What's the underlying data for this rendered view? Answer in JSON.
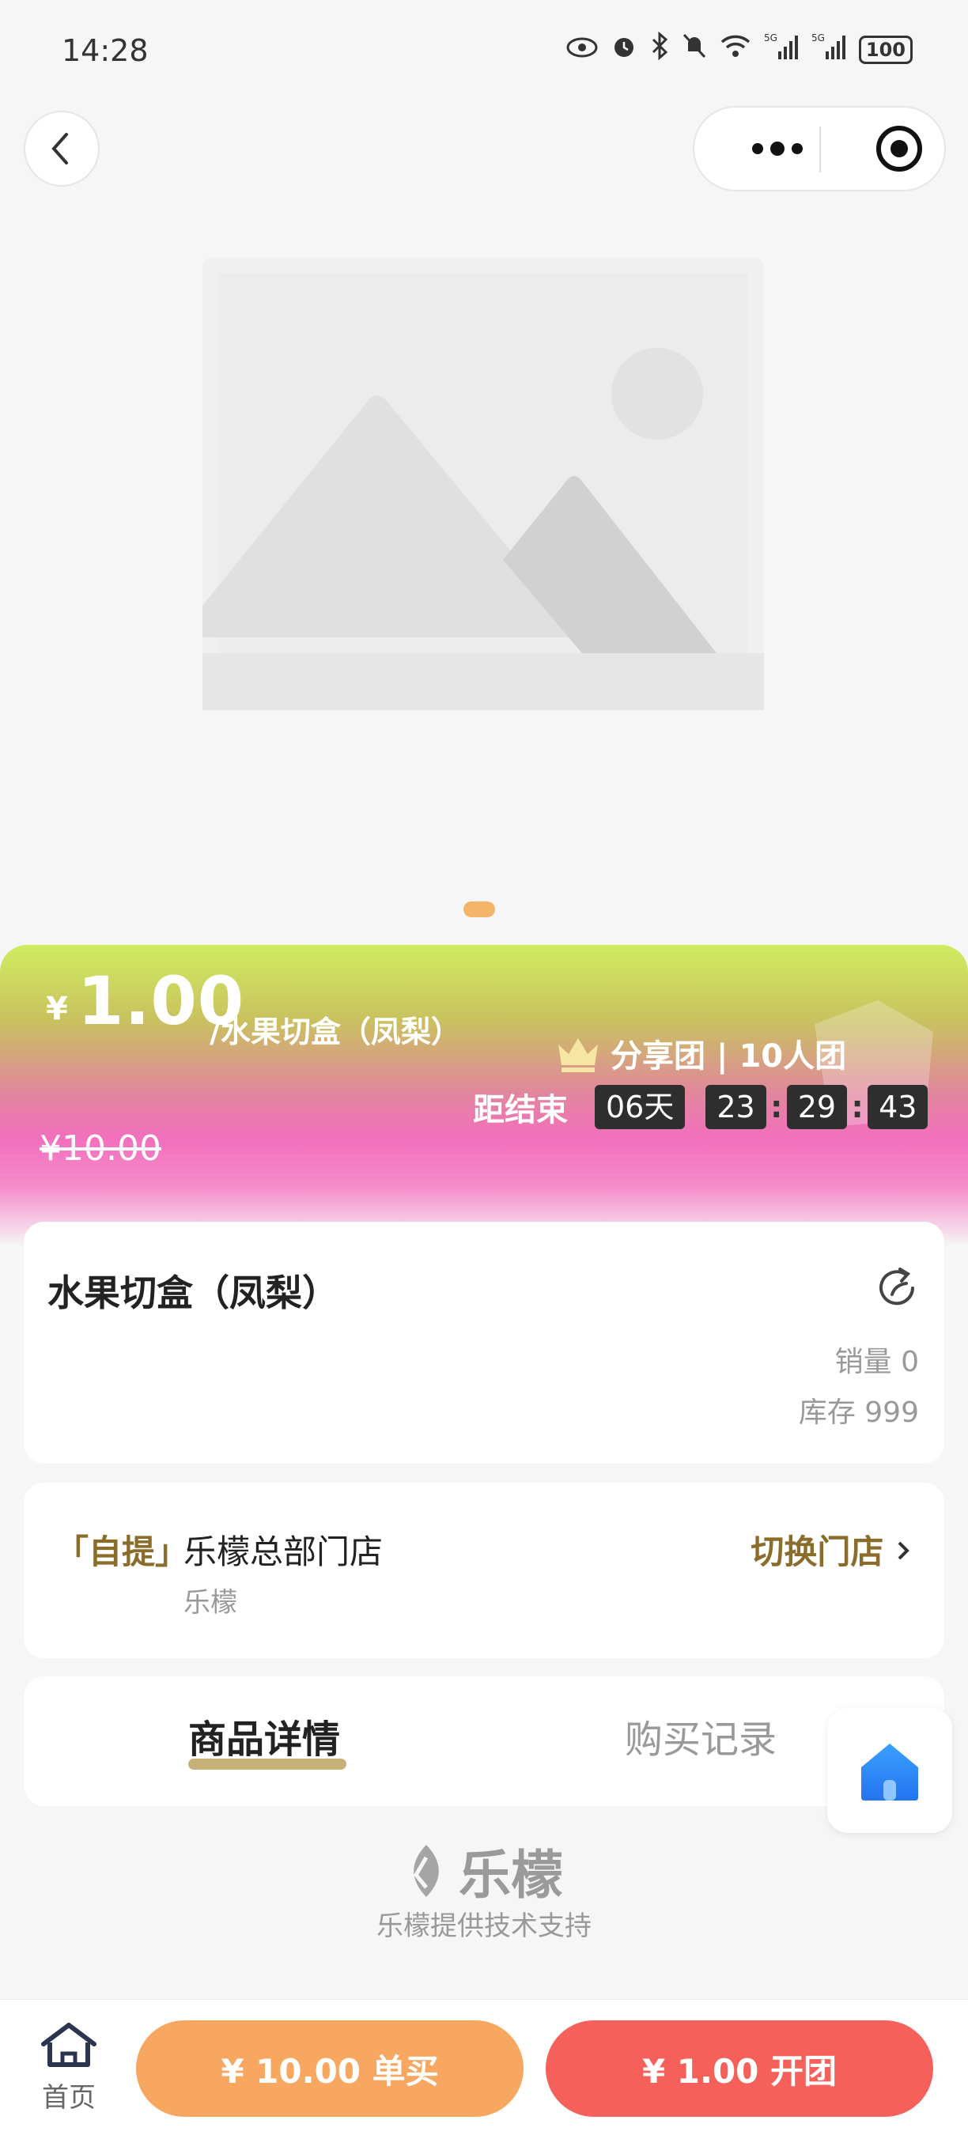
{
  "status_bar": {
    "time": "14:28",
    "icons": [
      "eye-icon",
      "alarm-icon",
      "bluetooth-icon",
      "mute-icon",
      "wifi-icon",
      "signal-5g-icon",
      "signal-5g-icon"
    ],
    "battery": "100"
  },
  "nav": {
    "back_icon": "chevron-left-icon",
    "more_icon": "more-dots-icon",
    "close_icon": "target-icon"
  },
  "gallery": {
    "image": "image-placeholder",
    "indicator_color": "#f3b56a"
  },
  "price": {
    "symbol": "¥",
    "value": "1.00",
    "unit": "/水果切盒（凤梨）",
    "original": "¥10.00",
    "group_type": "分享团 | 10人团",
    "countdown_label": "距结束",
    "days": "06天",
    "hours": "23",
    "minutes": "29",
    "seconds": "43",
    "colon": ":"
  },
  "product": {
    "title": "水果切盒（凤梨）",
    "sales": "销量 0",
    "stock": "库存 999"
  },
  "store": {
    "tag": "「自提」",
    "name": "乐檬总部门店",
    "sub": "乐檬",
    "switch_label": "切换门店"
  },
  "tabs": {
    "detail": "商品详情",
    "records": "购买记录"
  },
  "brand": {
    "logo_text": "乐檬",
    "support": "乐檬提供技术支持"
  },
  "bottom_bar": {
    "home_label": "首页",
    "buy_single": "¥ 10.00 单买",
    "open_group": "¥ 1.00 开团"
  },
  "colors": {
    "single_button": "#f7a760",
    "group_button": "#f5605a",
    "accent_gold": "#8a6d2a"
  }
}
